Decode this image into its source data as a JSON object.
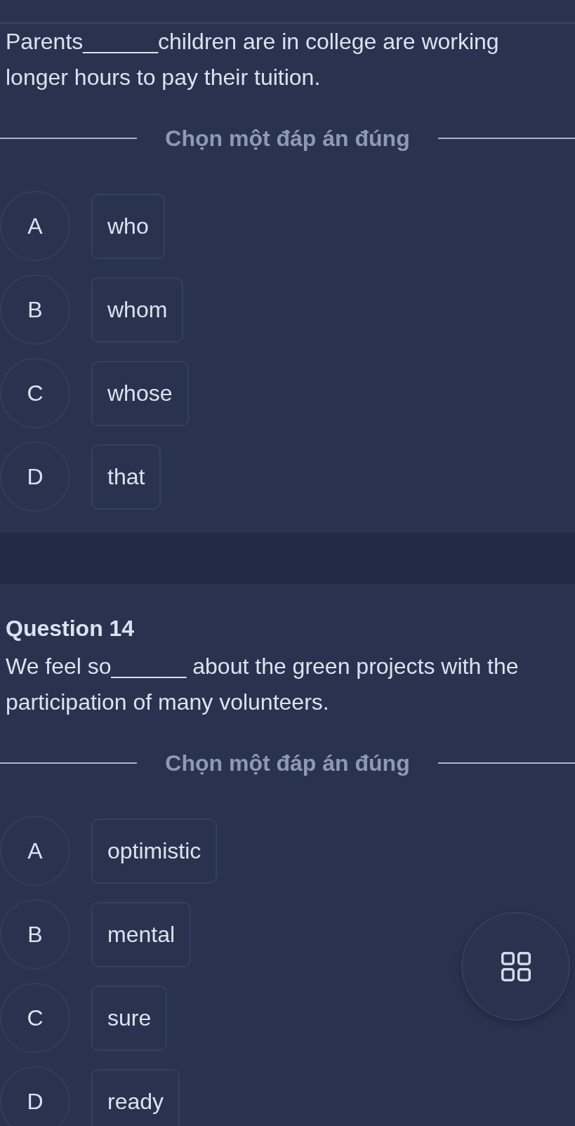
{
  "questions": [
    {
      "prompt": "Parents______children are in college are working longer hours to pay their tuition.",
      "instruction": "Chọn một đáp án đúng",
      "options": [
        {
          "letter": "A",
          "text": "who",
          "selected": false
        },
        {
          "letter": "B",
          "text": "whom",
          "selected": false
        },
        {
          "letter": "C",
          "text": "whose",
          "selected": false
        },
        {
          "letter": "D",
          "text": "that",
          "selected": false
        }
      ]
    },
    {
      "title": "Question 14",
      "prompt": "We feel so______ about the green projects with the participation of many volunteers.",
      "instruction": "Chọn một đáp án đúng",
      "options": [
        {
          "letter": "A",
          "text": "optimistic",
          "selected": false
        },
        {
          "letter": "B",
          "text": "mental",
          "selected": false
        },
        {
          "letter": "C",
          "text": "sure",
          "selected": false
        },
        {
          "letter": "D",
          "text": "ready",
          "selected": false
        }
      ]
    }
  ]
}
